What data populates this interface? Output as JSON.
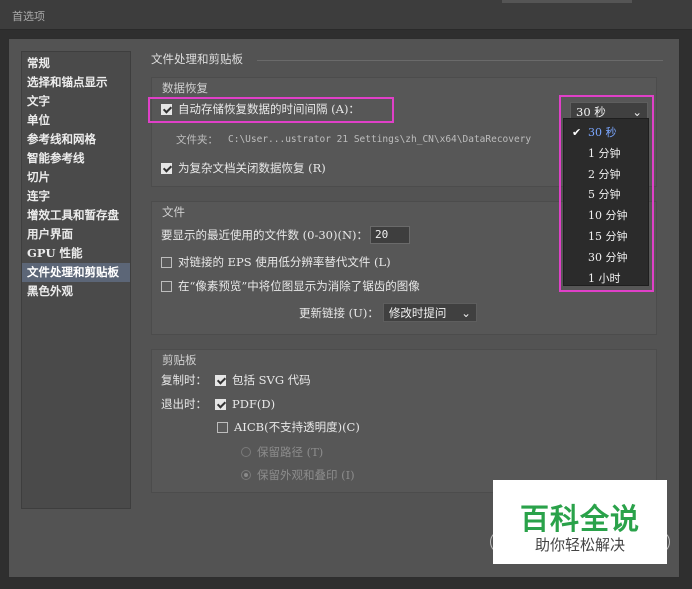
{
  "window": {
    "title": "首选项"
  },
  "sidebar": {
    "items": [
      {
        "label": "常规"
      },
      {
        "label": "选择和锚点显示"
      },
      {
        "label": "文字"
      },
      {
        "label": "单位"
      },
      {
        "label": "参考线和网格"
      },
      {
        "label": "智能参考线"
      },
      {
        "label": "切片"
      },
      {
        "label": "连字"
      },
      {
        "label": "增效工具和暂存盘"
      },
      {
        "label": "用户界面"
      },
      {
        "label": "GPU 性能"
      },
      {
        "label": "文件处理和剪贴板",
        "selected": true
      },
      {
        "label": "黑色外观"
      }
    ]
  },
  "main": {
    "title": "文件处理和剪贴板",
    "recovery": {
      "title": "数据恢复",
      "autosave_label": "自动存储恢复数据的时间间隔 (A)：",
      "autosave_checked": true,
      "interval_value": "30 秒",
      "folder_label": "文件夹：",
      "folder_path": "C:\\User...ustrator 21 Settings\\zh_CN\\x64\\DataRecovery",
      "complex_label": "为复杂文档关闭数据恢复 (R)",
      "complex_checked": true
    },
    "interval_options": [
      "30 秒",
      "1 分钟",
      "2 分钟",
      "5 分钟",
      "10 分钟",
      "15 分钟",
      "30 分钟",
      "1 小时"
    ],
    "files": {
      "title": "文件",
      "recent_label": "要显示的最近使用的文件数 (0-30)(N)：",
      "recent_value": "20",
      "eps_label": "对链接的 EPS 使用低分辨率替代文件 (L)",
      "eps_checked": false,
      "pixel_label": "在“像素预览”中将位图显示为消除了锯齿的图像",
      "pixel_checked": false,
      "update_label": "更新链接 (U)：",
      "update_value": "修改时提问"
    },
    "clipboard": {
      "title": "剪贴板",
      "copy_label": "复制时：",
      "copy_svg_label": "包括 SVG 代码",
      "copy_svg_checked": true,
      "exit_label": "退出时：",
      "pdf_label": "PDF(D)",
      "pdf_checked": true,
      "aicb_label": "AICB(不支持透明度)(C)",
      "aicb_checked": false,
      "preserve_paths_label": "保留路径 (T)",
      "preserve_appearance_label": "保留外观和叠印 (I)"
    }
  },
  "watermark": {
    "line1": "百科全说",
    "line2": "助你轻松解决"
  },
  "colors": {
    "highlight": "#e040c8",
    "selected_sidebar": "#5c6677",
    "watermark_green": "#2aa24a"
  }
}
